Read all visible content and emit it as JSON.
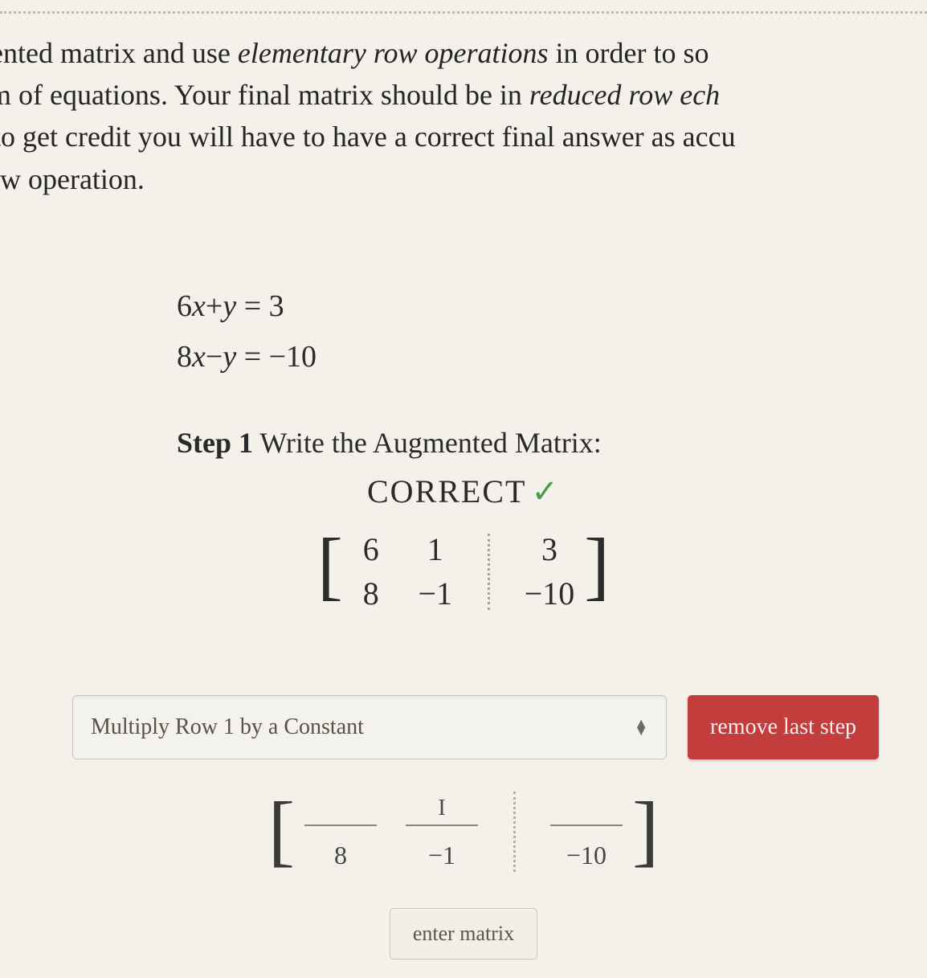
{
  "prompt": {
    "line1_a": "nented matrix and use ",
    "line1_b": "elementary row operations",
    "line1_c": " in order to so",
    "line2_a": "em of equations. Your final matrix should be in ",
    "line2_b": "reduced row ech",
    "line3": "r to get credit you will have to have a correct final answer as accu",
    "line4": "row operation."
  },
  "equations": {
    "eq1_lhs_a": "6",
    "eq1_lhs_b": "x",
    "eq1_lhs_c": "+",
    "eq1_lhs_d": "y",
    "eq1_rhs": " = 3",
    "eq2_lhs_a": "8",
    "eq2_lhs_b": "x",
    "eq2_lhs_c": "−",
    "eq2_lhs_d": "y",
    "eq2_rhs": " = −10"
  },
  "step": {
    "label_bold": "Step 1",
    "label_rest": " Write the Augmented Matrix:"
  },
  "feedback": {
    "text": "CORRECT",
    "check": "✓"
  },
  "matrix1": {
    "r1c1": "6",
    "r1c2": "1",
    "r1c3": "3",
    "r2c1": "8",
    "r2c2": "−1",
    "r2c3": "−10"
  },
  "operation_select": {
    "value": "Multiply Row 1 by a Constant"
  },
  "remove_button": "remove last step",
  "matrix2": {
    "r1c1": "",
    "r1c2_cursor": "I",
    "r1c3": "",
    "r2c1": "8",
    "r2c2": "−1",
    "r2c3": "−10"
  },
  "enter_button": "enter matrix"
}
